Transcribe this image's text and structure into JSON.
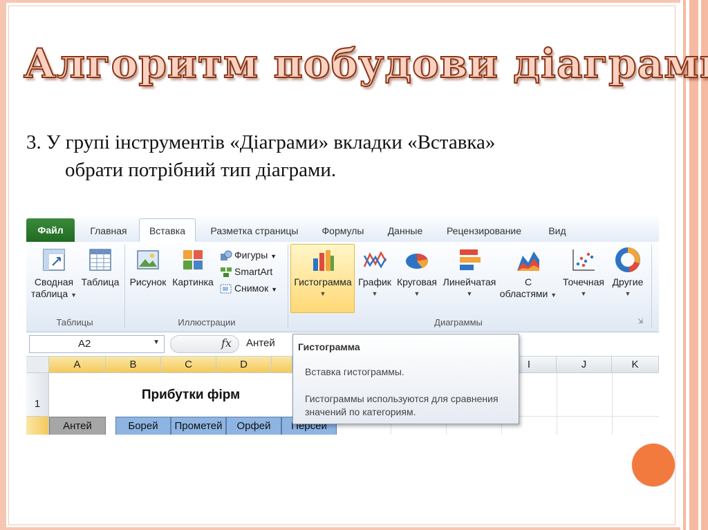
{
  "slide": {
    "title": "Алгоритм побудови діаграми",
    "step_line1": "3. У групі інструментів «Діаграми» вкладки «Вставка»",
    "step_line2": "обрати потрібний тип діаграми."
  },
  "excel": {
    "tabs": [
      "Файл",
      "Главная",
      "Вставка",
      "Разметка страницы",
      "Формулы",
      "Данные",
      "Рецензирование",
      "Вид"
    ],
    "active_tab": "Вставка",
    "groups": {
      "tables": {
        "label": "Таблицы",
        "pivot_line1": "Сводная",
        "pivot_line2": "таблица",
        "table": "Таблица"
      },
      "illustrations": {
        "label": "Иллюстрации",
        "picture": "Рисунок",
        "clipart": "Картинка",
        "shapes": "Фигуры",
        "smartart": "SmartArt",
        "screenshot": "Снимок"
      },
      "charts": {
        "label": "Диаграммы",
        "histogram": "Гистограмма",
        "line": "График",
        "pie": "Круговая",
        "bar": "Линейчатая",
        "area_line1": "С",
        "area_line2": "областями",
        "scatter": "Точечная",
        "other": "Другие"
      }
    },
    "name_box": "A2",
    "fx_label": "fx",
    "formula_value": "Антей",
    "columns": [
      "A",
      "B",
      "C",
      "D",
      "I",
      "J",
      "K"
    ],
    "rows": [
      "1"
    ],
    "merged_title": "Прибутки фірм",
    "header_cells": [
      "Антей",
      "Борей",
      "Прометей",
      "Орфей",
      "Персей"
    ],
    "tooltip": {
      "title": "Гистограмма",
      "line1": "Вставка гистограммы.",
      "line2": "Гистограммы используются для сравнения значений по категориям."
    }
  },
  "colors": {
    "title_fill": "#fbd2c2",
    "title_outline": "#8a3516",
    "frame": "#f6b9a1",
    "accent_dot": "#f37a3e",
    "file_tab": "#2a7a2c",
    "selected_header": "#f4c95c",
    "header_cells": "#8db4e2"
  }
}
